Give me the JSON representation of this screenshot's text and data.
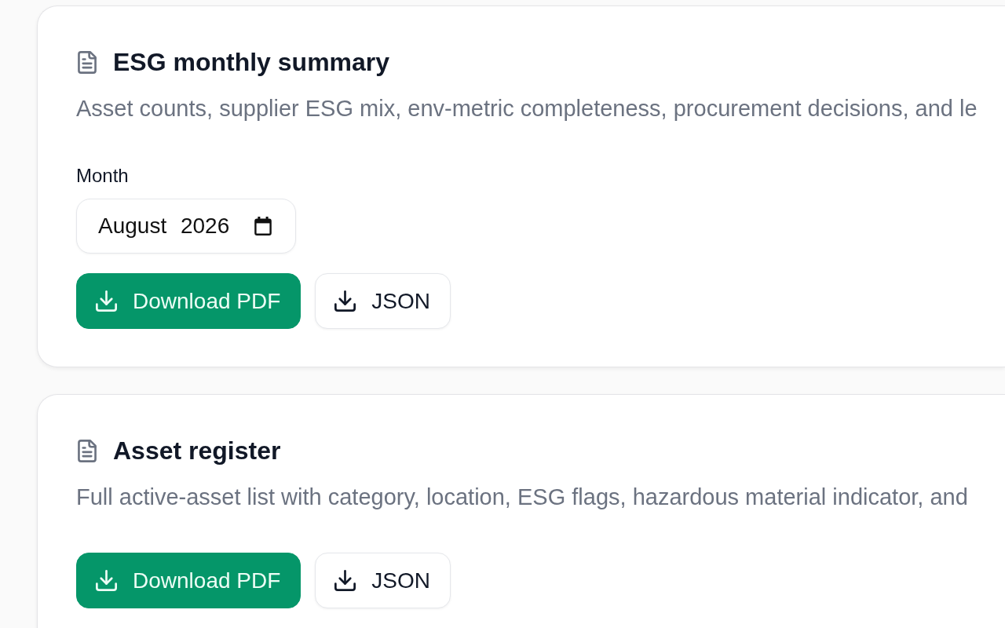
{
  "reports": [
    {
      "title": "ESG monthly summary",
      "description": "Asset counts, supplier ESG mix, env-metric completeness, procurement decisions, and le",
      "month_field": {
        "label": "Month",
        "value": "August 2026"
      },
      "actions": [
        {
          "kind": "primary",
          "label": "Download PDF"
        },
        {
          "kind": "secondary",
          "label": "JSON"
        }
      ]
    },
    {
      "title": "Asset register",
      "description": "Full active-asset list with category, location, ESG flags, hazardous material indicator, and",
      "actions": [
        {
          "kind": "primary",
          "label": "Download PDF"
        },
        {
          "kind": "secondary",
          "label": "JSON"
        }
      ]
    }
  ]
}
